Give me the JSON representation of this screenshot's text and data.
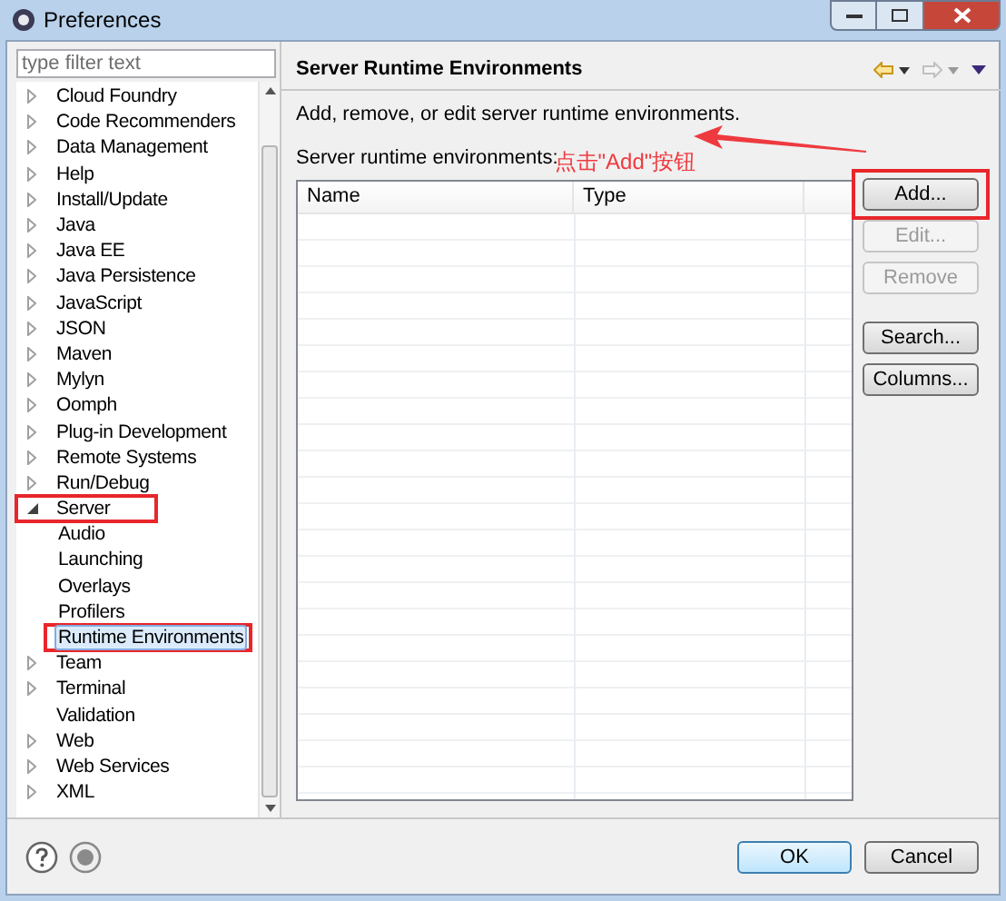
{
  "window": {
    "title": "Preferences"
  },
  "filter": {
    "placeholder": "type filter text"
  },
  "tree": [
    {
      "label": "Cloud Foundry",
      "expanded": false
    },
    {
      "label": "Code Recommenders",
      "expanded": false
    },
    {
      "label": "Data Management",
      "expanded": false
    },
    {
      "label": "Help",
      "expanded": false
    },
    {
      "label": "Install/Update",
      "expanded": false
    },
    {
      "label": "Java",
      "expanded": false
    },
    {
      "label": "Java EE",
      "expanded": false
    },
    {
      "label": "Java Persistence",
      "expanded": false
    },
    {
      "label": "JavaScript",
      "expanded": false
    },
    {
      "label": "JSON",
      "expanded": false
    },
    {
      "label": "Maven",
      "expanded": false
    },
    {
      "label": "Mylyn",
      "expanded": false
    },
    {
      "label": "Oomph",
      "expanded": false
    },
    {
      "label": "Plug-in Development",
      "expanded": false
    },
    {
      "label": "Remote Systems",
      "expanded": false
    },
    {
      "label": "Run/Debug",
      "expanded": false
    },
    {
      "label": "Server",
      "expanded": true,
      "highlighted": true,
      "children": [
        {
          "label": "Audio",
          "selected": false,
          "highlighted": false
        },
        {
          "label": "Launching",
          "selected": false,
          "highlighted": false
        },
        {
          "label": "Overlays",
          "selected": false,
          "highlighted": false
        },
        {
          "label": "Profilers",
          "selected": false,
          "highlighted": false
        },
        {
          "label": "Runtime Environments",
          "selected": true,
          "highlighted": true
        }
      ]
    },
    {
      "label": "Team",
      "expanded": false
    },
    {
      "label": "Terminal",
      "expanded": false
    },
    {
      "label": "Validation"
    },
    {
      "label": "Web",
      "expanded": false
    },
    {
      "label": "Web Services",
      "expanded": false
    },
    {
      "label": "XML",
      "expanded": false
    }
  ],
  "page": {
    "title": "Server Runtime Environments",
    "description": "Add, remove, or edit server runtime environments.",
    "list_label": "Server runtime environments:"
  },
  "table": {
    "columns": [
      "Name",
      "Type"
    ]
  },
  "side_buttons": [
    {
      "label": "Add...",
      "disabled": false,
      "highlighted": true
    },
    {
      "label": "Edit...",
      "disabled": true,
      "highlighted": false
    },
    {
      "label": "Remove",
      "disabled": true,
      "highlighted": false
    },
    {
      "label": "Search...",
      "disabled": false,
      "highlighted": false
    },
    {
      "label": "Columns...",
      "disabled": false,
      "highlighted": false
    }
  ],
  "annotation": {
    "text": "点击\"Add\"按钮"
  },
  "buttons": [
    {
      "label": "OK",
      "default": true
    },
    {
      "label": "Cancel",
      "default": false
    }
  ]
}
